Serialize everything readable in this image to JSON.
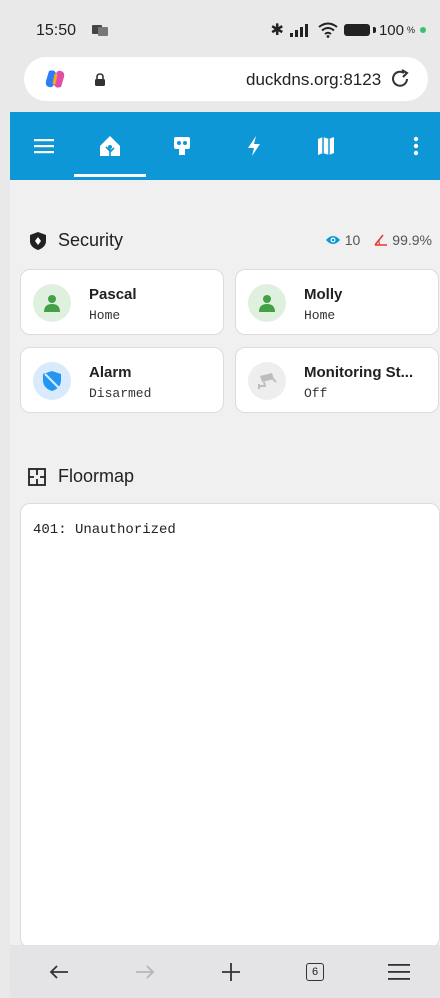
{
  "status_bar": {
    "time": "15:50",
    "battery": "100",
    "battery_unit": "%"
  },
  "browser": {
    "url": "duckdns.org:8123"
  },
  "app_bar": {
    "tabs": [
      "menu-icon",
      "home-assistant-icon",
      "robot-icon",
      "energy-icon",
      "map-icon",
      "more-icon"
    ],
    "active_tab": 1,
    "accent": "#0e97d6"
  },
  "security": {
    "title": "Security",
    "eye_count": "10",
    "ratio": "99.9%",
    "cards": [
      {
        "title": "Pascal",
        "state": "Home",
        "icon": "person-icon",
        "icon_color": "#43a047",
        "icon_bg": "#dff0df"
      },
      {
        "title": "Molly",
        "state": "Home",
        "icon": "person-icon",
        "icon_color": "#43a047",
        "icon_bg": "#dff0df"
      },
      {
        "title": "Alarm",
        "state": "Disarmed",
        "icon": "shield-icon",
        "icon_color": "#2196f3",
        "icon_bg": "#d8eafc"
      },
      {
        "title": "Monitoring St...",
        "state": "Off",
        "icon": "cctv-icon",
        "icon_color": "#bdbdbd",
        "icon_bg": "#eeeeee"
      }
    ]
  },
  "floormap": {
    "title": "Floormap",
    "message": "401: Unauthorized"
  }
}
